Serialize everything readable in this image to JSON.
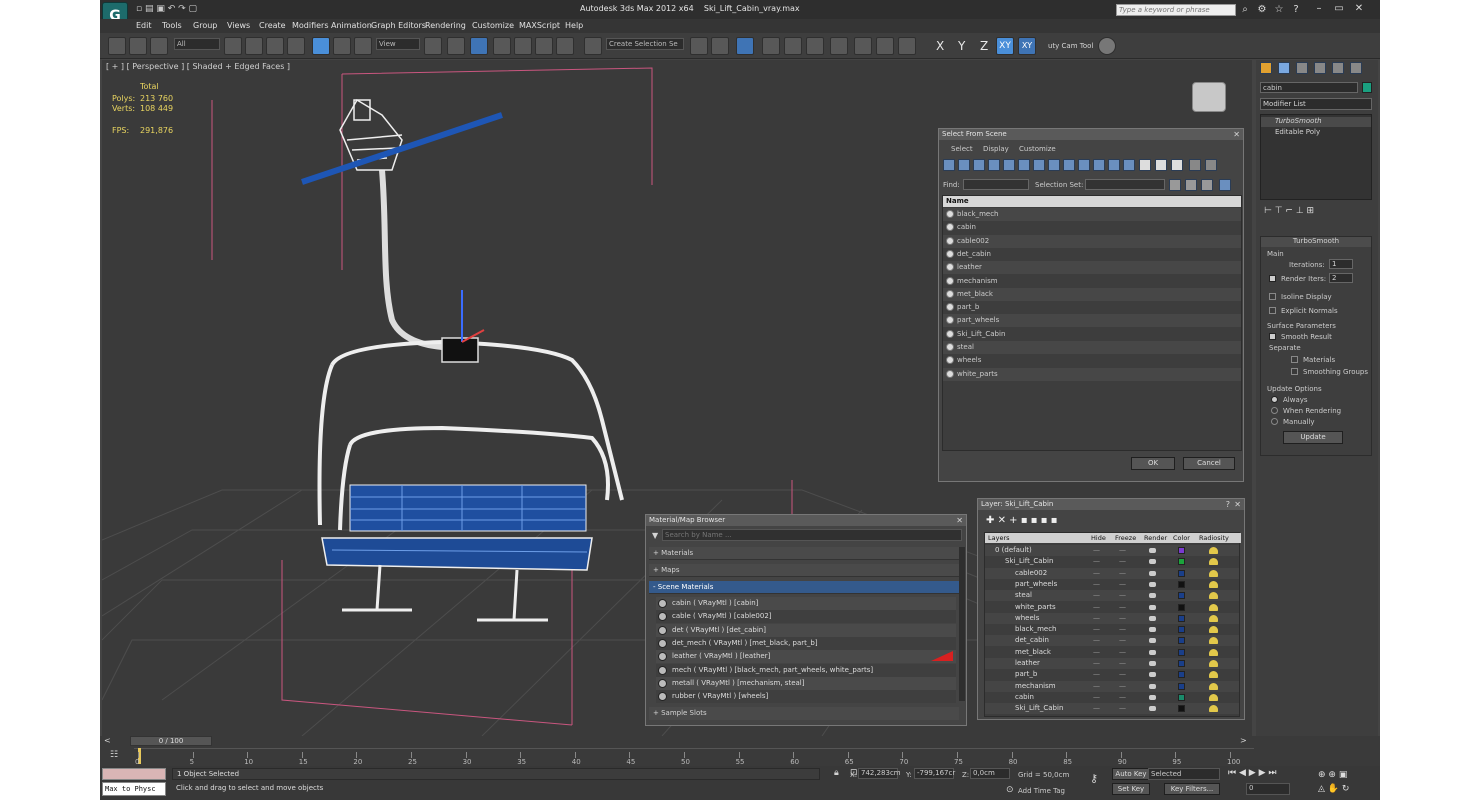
{
  "titlebar": {
    "app": "Autodesk 3ds Max  2012 x64",
    "file": "Ski_Lift_Cabin_vray.max",
    "search_placeholder": "Type a keyword or phrase"
  },
  "menu": [
    "Edit",
    "Tools",
    "Group",
    "Views",
    "Create",
    "Modifiers",
    "Animation",
    "Graph Editors",
    "Rendering",
    "Customize",
    "MAXScript",
    "Help"
  ],
  "toolbar": {
    "selection_filter": "All",
    "ref_coord": "View",
    "selection_set": "Create Selection Se",
    "axes": [
      "X",
      "Y",
      "Z",
      "XY",
      "XY"
    ],
    "cam_tool": "uty Cam Tool"
  },
  "viewport": {
    "label": "[ + ] [ Perspective ] [ Shaded + Edged Faces ]",
    "stats_header": "Total",
    "polys_label": "Polys:",
    "polys_value": "213 760",
    "verts_label": "Verts:",
    "verts_value": "108 449",
    "fps_label": "FPS:",
    "fps_value": "291,876"
  },
  "select_from_scene": {
    "title": "Select From Scene",
    "menu": [
      "Select",
      "Display",
      "Customize"
    ],
    "find_label": "Find:",
    "selection_set_label": "Selection Set:",
    "column": "Name",
    "items": [
      "black_mech",
      "cabin",
      "cable002",
      "det_cabin",
      "leather",
      "mechanism",
      "met_black",
      "part_b",
      "part_wheels",
      "Ski_Lift_Cabin",
      "steal",
      "wheels",
      "white_parts"
    ],
    "ok": "OK",
    "cancel": "Cancel"
  },
  "material_browser": {
    "title": "Material/Map Browser",
    "search_placeholder": "Search by Name ...",
    "sections": [
      "+ Materials",
      "+ Maps",
      "- Scene Materials"
    ],
    "scene_materials": [
      "cabin  ( VRayMtl )  [cabin]",
      "cable  ( VRayMtl )  [cable002]",
      "det  ( VRayMtl )  [det_cabin]",
      "det_mech  ( VRayMtl )  [met_black, part_b]",
      "leather  ( VRayMtl )  [leather]",
      "mech  ( VRayMtl )  [black_mech, part_wheels, white_parts]",
      "metall  ( VRayMtl )  [mechanism, steal]",
      "rubber  ( VRayMtl )  [wheels]"
    ],
    "sample_slots": "+ Sample Slots"
  },
  "layer_dialog": {
    "title": "Layer: Ski_Lift_Cabin",
    "help": "?",
    "columns": [
      "Layers",
      "Hide",
      "Freeze",
      "Render",
      "Color",
      "Radiosity"
    ],
    "layers": [
      {
        "name": "0 (default)",
        "color": "#7a3ad0",
        "indent": 0
      },
      {
        "name": "Ski_Lift_Cabin",
        "color": "#1ca43c",
        "indent": 1
      },
      {
        "name": "cable002",
        "color": "#1a3f8a",
        "indent": 2
      },
      {
        "name": "part_wheels",
        "color": "#111111",
        "indent": 2
      },
      {
        "name": "steal",
        "color": "#1a3f8a",
        "indent": 2
      },
      {
        "name": "white_parts",
        "color": "#111111",
        "indent": 2
      },
      {
        "name": "wheels",
        "color": "#1a3f8a",
        "indent": 2
      },
      {
        "name": "black_mech",
        "color": "#1a3f8a",
        "indent": 2
      },
      {
        "name": "det_cabin",
        "color": "#1a3f8a",
        "indent": 2
      },
      {
        "name": "met_black",
        "color": "#1a3f8a",
        "indent": 2
      },
      {
        "name": "leather",
        "color": "#1a3f8a",
        "indent": 2
      },
      {
        "name": "part_b",
        "color": "#1a3f8a",
        "indent": 2
      },
      {
        "name": "mechanism",
        "color": "#1a3f8a",
        "indent": 2
      },
      {
        "name": "cabin",
        "color": "#1a8a6a",
        "indent": 2
      },
      {
        "name": "Ski_Lift_Cabin",
        "color": "#111111",
        "indent": 2
      }
    ]
  },
  "command_panel": {
    "object_name": "cabin",
    "modifier_list": "Modifier List",
    "stack": [
      "TurboSmooth",
      "Editable Poly"
    ],
    "rollout": "TurboSmooth",
    "main": "Main",
    "iterations_label": "Iterations:",
    "iterations_value": "1",
    "render_iters_label": "Render Iters:",
    "render_iters_value": "2",
    "isoline": "Isoline Display",
    "explicit": "Explicit Normals",
    "surface_params": "Surface Parameters",
    "smooth_result": "Smooth Result",
    "separate": "Separate",
    "materials": "Materials",
    "smoothing_groups": "Smoothing Groups",
    "update_options": "Update Options",
    "always": "Always",
    "when_rendering": "When Rendering",
    "manually": "Manually",
    "update": "Update"
  },
  "timeline": {
    "frame": "0 / 100",
    "ticks": [
      "0",
      "5",
      "10",
      "15",
      "20",
      "25",
      "30",
      "35",
      "40",
      "45",
      "50",
      "55",
      "60",
      "65",
      "70",
      "75",
      "80",
      "85",
      "90",
      "95",
      "100"
    ]
  },
  "status": {
    "selected": "1 Object Selected",
    "prompt": "Click and drag to select and move objects",
    "maxscript": "Max to Physc",
    "x_label": "X:",
    "x_value": "742,283cm",
    "y_label": "Y:",
    "y_value": "-799,167cr",
    "z_label": "Z:",
    "z_value": "0,0cm",
    "grid": "Grid = 50,0cm",
    "add_time_tag": "Add Time Tag",
    "auto_key": "Auto Key",
    "set_key": "Set Key",
    "key_mode": "Selected",
    "key_filters": "Key Filters...",
    "frame_field": "0"
  }
}
